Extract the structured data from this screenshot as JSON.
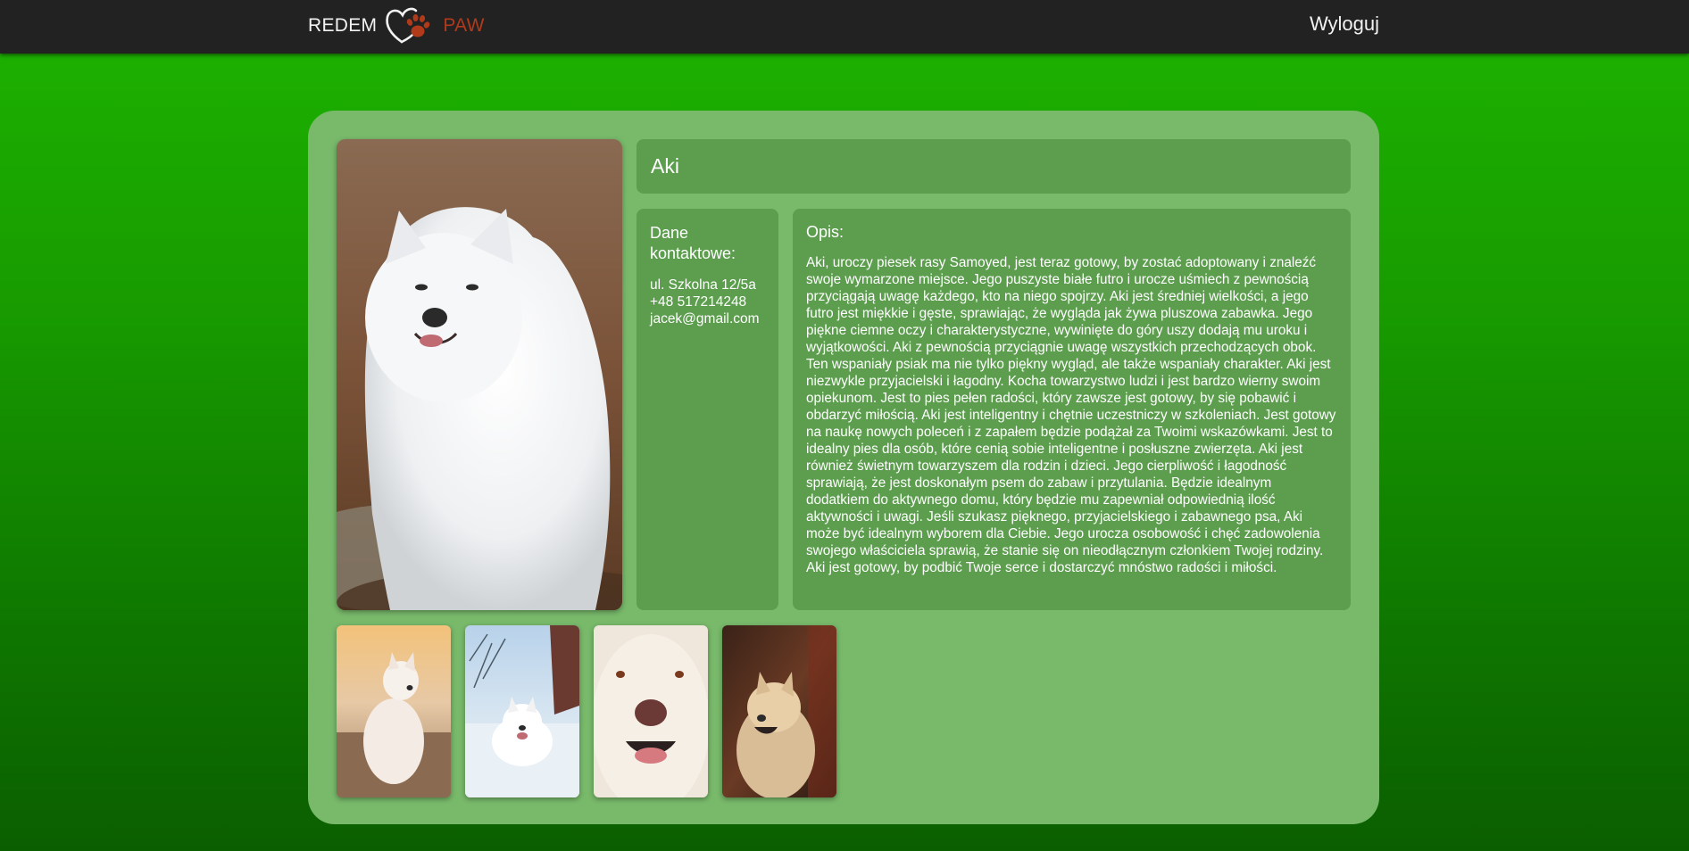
{
  "navbar": {
    "brand_left": "REDEM",
    "brand_right": "PAW",
    "logo_icon": "heart-paw-icon",
    "logout_label": "Wyloguj"
  },
  "pet": {
    "name": "Aki",
    "contact": {
      "heading": "Dane kontaktowe:",
      "address": "ul. Szkolna 12/5a",
      "phone": "+48 517214248",
      "email": "jacek@gmail.com"
    },
    "description": {
      "heading": "Opis:",
      "text": "Aki, uroczy piesek rasy Samoyed, jest teraz gotowy, by zostać adoptowany i znaleźć swoje wymarzone miejsce. Jego puszyste białe futro i urocze uśmiech z pewnością przyciągają uwagę każdego, kto na niego spojrzy. Aki jest średniej wielkości, a jego futro jest miękkie i gęste, sprawiając, że wygląda jak żywa pluszowa zabawka. Jego piękne ciemne oczy i charakterystyczne, wywinięte do góry uszy dodają mu uroku i wyjątkowości. Aki z pewnością przyciągnie uwagę wszystkich przechodzących obok. Ten wspaniały psiak ma nie tylko piękny wygląd, ale także wspaniały charakter. Aki jest niezwykle przyjacielski i łagodny. Kocha towarzystwo ludzi i jest bardzo wierny swoim opiekunom. Jest to pies pełen radości, który zawsze jest gotowy, by się pobawić i obdarzyć miłością. Aki jest inteligentny i chętnie uczestniczy w szkoleniach. Jest gotowy na naukę nowych poleceń i z zapałem będzie podążał za Twoimi wskazówkami. Jest to idealny pies dla osób, które cenią sobie inteligentne i posłuszne zwierzęta. Aki jest również świetnym towarzyszem dla rodzin i dzieci. Jego cierpliwość i łagodność sprawiają, że jest doskonałym psem do zabaw i przytulania. Będzie idealnym dodatkiem do aktywnego domu, który będzie mu zapewniał odpowiednią ilość aktywności i uwagi. Jeśli szukasz pięknego, przyjacielskiego i zabawnego psa, Aki może być idealnym wyborem dla Ciebie. Jego urocza osobowość i chęć zadowolenia swojego właściciela sprawią, że stanie się on nieodłącznym członkiem Twojej rodziny. Aki jest gotowy, by podbić Twoje serce i dostarczyć mnóstwo radości i miłości."
    }
  },
  "colors": {
    "navbar_bg": "#222222",
    "brand_accent": "#b03a1a",
    "card_bg": "#78b96a",
    "panel_bg": "#5c9e4e"
  }
}
